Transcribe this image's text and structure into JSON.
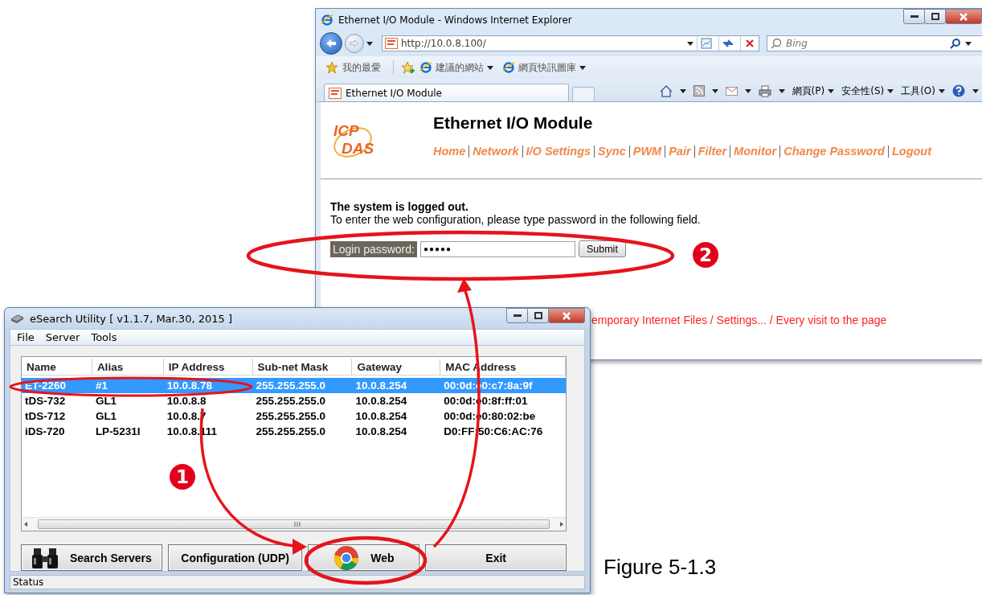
{
  "browser": {
    "title": "Ethernet I/O Module - Windows Internet Explorer",
    "address": "http://10.0.8.100/",
    "search_placeholder": "Bing",
    "favorites": "我的最愛",
    "favorites_links": [
      "建議的網站",
      "網頁快訊圖庫"
    ],
    "tab": "Ethernet I/O Module",
    "commands": [
      "網頁(P)",
      "安全性(S)",
      "工具(O)"
    ],
    "page": {
      "logo": [
        "ICP",
        "DAS"
      ],
      "heading": "Ethernet I/O Module",
      "nav": [
        "Home",
        "Network",
        "I/O Settings",
        "Sync",
        "PWM",
        "Pair",
        "Filter",
        "Monitor",
        "Change Password",
        "Logout"
      ],
      "message_title": "The system is logged out.",
      "message": "To enter the web configuration, please type password in the following field.",
      "password_label": "Login password:",
      "password_value": "●●●●●",
      "submit": "Submit",
      "note": "emporary Internet Files / Settings... / Every visit to the page"
    }
  },
  "utility": {
    "title": "eSearch Utility [ v1.1.7, Mar.30, 2015 ]",
    "menu": [
      "File",
      "Server",
      "Tools"
    ],
    "columns": [
      "Name",
      "Alias",
      "IP Address",
      "Sub-net Mask",
      "Gateway",
      "MAC Address"
    ],
    "rows": [
      {
        "cells": [
          "ET-2260",
          "#1",
          "10.0.8.78",
          "255.255.255.0",
          "10.0.8.254",
          "00:0d:e0:c7:8a:9f"
        ],
        "selected": true
      },
      {
        "cells": [
          "tDS-732",
          "GL1",
          "10.0.8.8",
          "255.255.255.0",
          "10.0.8.254",
          "00:0d:e0:8f:ff:01"
        ],
        "selected": false
      },
      {
        "cells": [
          "tDS-712",
          "GL1",
          "10.0.8.7",
          "255.255.255.0",
          "10.0.8.254",
          "00:0d:e0:80:02:be"
        ],
        "selected": false
      },
      {
        "cells": [
          "iDS-720",
          "LP-5231I",
          "10.0.8.111",
          "255.255.255.0",
          "10.0.8.254",
          "D0:FF:50:C6:AC:76"
        ],
        "selected": false
      }
    ],
    "buttons": [
      {
        "kind": "search",
        "label": "Search Servers"
      },
      {
        "kind": "plain",
        "label": "Configuration (UDP)"
      },
      {
        "kind": "web",
        "label": "Web"
      },
      {
        "kind": "plain",
        "label": "Exit"
      }
    ],
    "status": "Status"
  },
  "callouts": [
    "1",
    "2"
  ],
  "caption": "Figure 5-1.3"
}
